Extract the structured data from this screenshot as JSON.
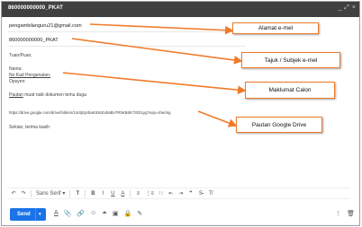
{
  "window": {
    "title": "860000000000_PKAT",
    "buttons": [
      "_",
      "⤢",
      "×"
    ]
  },
  "fields": {
    "to": "pengambilanguru21@gmail.com",
    "subject": "860000000000_PKAT"
  },
  "body": {
    "greeting": "Tuan/Puan,",
    "name_label": "Nama:",
    "ic_label": "No Kad Pengenalan:",
    "option_label": "Opsyen:",
    "note_link": "Pautan",
    "note_text": " muat naik dokumen temu duga",
    "drive_url": "https://drive.google.com/drive/folders/1mSjEprbaKS8cExb6BvTRbKBdK7zEb1yg?usp=sharing",
    "closing": "Sekian, terima kasih"
  },
  "callouts": {
    "email": "Alamat e-mel",
    "subject": "Tajuk / Subjek e-mel",
    "info": "Maklumat Calon",
    "drive": "Pautan Google Drive"
  },
  "toolbar": {
    "undo": "↶",
    "redo": "↷",
    "font": "Sans Serif",
    "size": "T",
    "bold": "B",
    "italic": "I",
    "underline": "U",
    "color": "A",
    "align": "≡",
    "numbered": "⋮≡",
    "bulleted": "∷",
    "indent_less": "⇤",
    "indent_more": "⇥",
    "quote": "❞",
    "strike": "S̶",
    "clear": "T̸"
  },
  "bottom": {
    "send": "Send",
    "caret": "▾",
    "icons": [
      "A",
      "📎",
      "🔗",
      "☺",
      "⏶",
      "▣",
      "🔒",
      "✎"
    ],
    "more": "⋮",
    "trash": "🗑"
  },
  "colors": {
    "accent": "#f07a2a",
    "send": "#1a73e8",
    "titlebar": "#404040"
  }
}
